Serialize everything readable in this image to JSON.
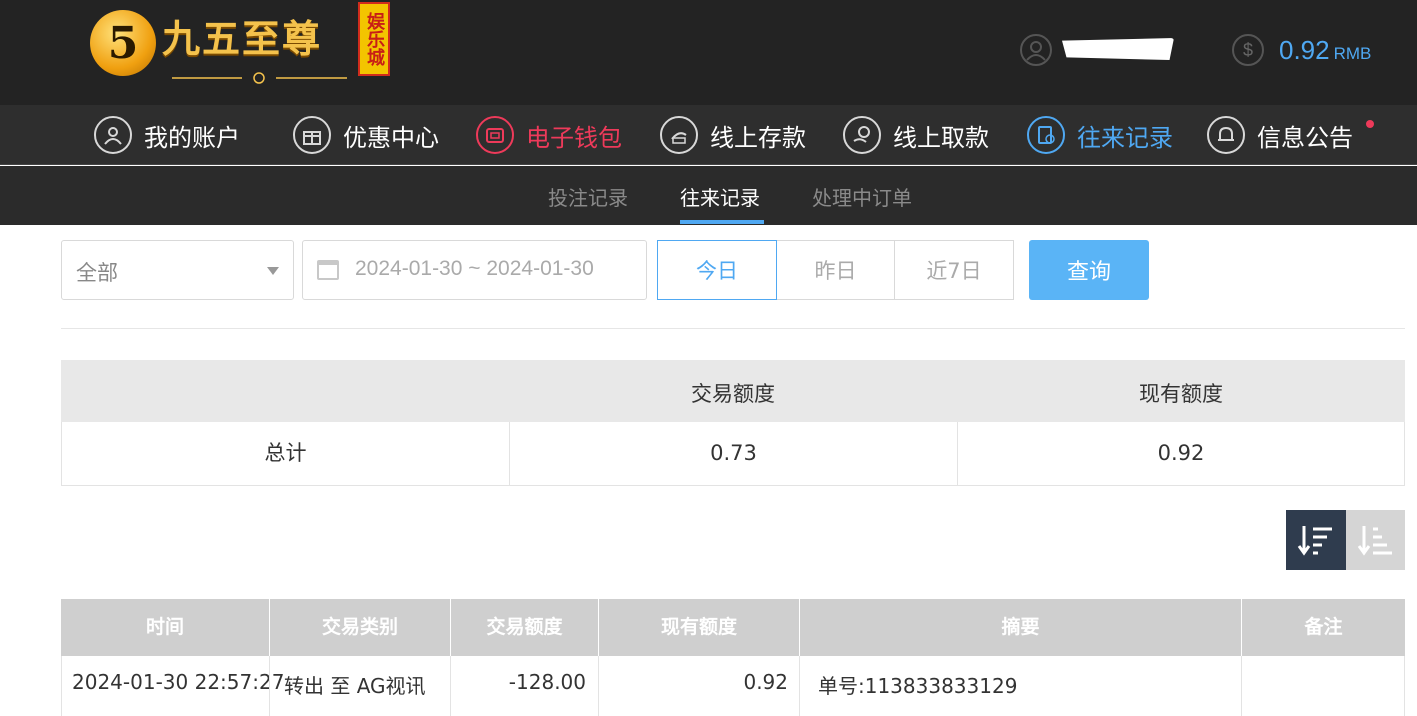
{
  "header": {
    "logo_badge": "5",
    "logo_title": "九五至尊",
    "logo_seal": "娱乐城",
    "username": "",
    "balance": "0.92",
    "currency": "RMB"
  },
  "colors": {
    "accent_blue": "#4fa8f2",
    "accent_red": "#ee3a5a",
    "header_bg": "#232323"
  },
  "nav": {
    "items": [
      {
        "label": "我的账户",
        "icon": "user-icon"
      },
      {
        "label": "优惠中心",
        "icon": "gift-icon"
      },
      {
        "label": "电子钱包",
        "icon": "wallet-icon"
      },
      {
        "label": "线上存款",
        "icon": "deposit-icon"
      },
      {
        "label": "线上取款",
        "icon": "withdraw-icon"
      },
      {
        "label": "往来记录",
        "icon": "records-icon"
      },
      {
        "label": "信息公告",
        "icon": "bell-icon"
      }
    ]
  },
  "subnav": {
    "items": [
      "投注记录",
      "往来记录",
      "处理中订单"
    ],
    "active": "往来记录"
  },
  "filter": {
    "type_value": "全部",
    "date_range": "2024-01-30 ~ 2024-01-30",
    "today": "今日",
    "yesterday": "昨日",
    "last7": "近7日",
    "query": "查询"
  },
  "summary": {
    "headers": [
      "",
      "交易额度",
      "现有额度"
    ],
    "row_label": "总计",
    "trade_amount": "0.73",
    "current_amount": "0.92"
  },
  "table": {
    "headers": [
      "时间",
      "交易类别",
      "交易额度",
      "现有额度",
      "摘要",
      "备注"
    ],
    "rows": [
      {
        "time": "2024-01-30 22:57:27",
        "type": "转出 至 AG视讯",
        "amount": "-128.00",
        "balance": "0.92",
        "summary": "单号:113833833129",
        "note": ""
      }
    ]
  }
}
